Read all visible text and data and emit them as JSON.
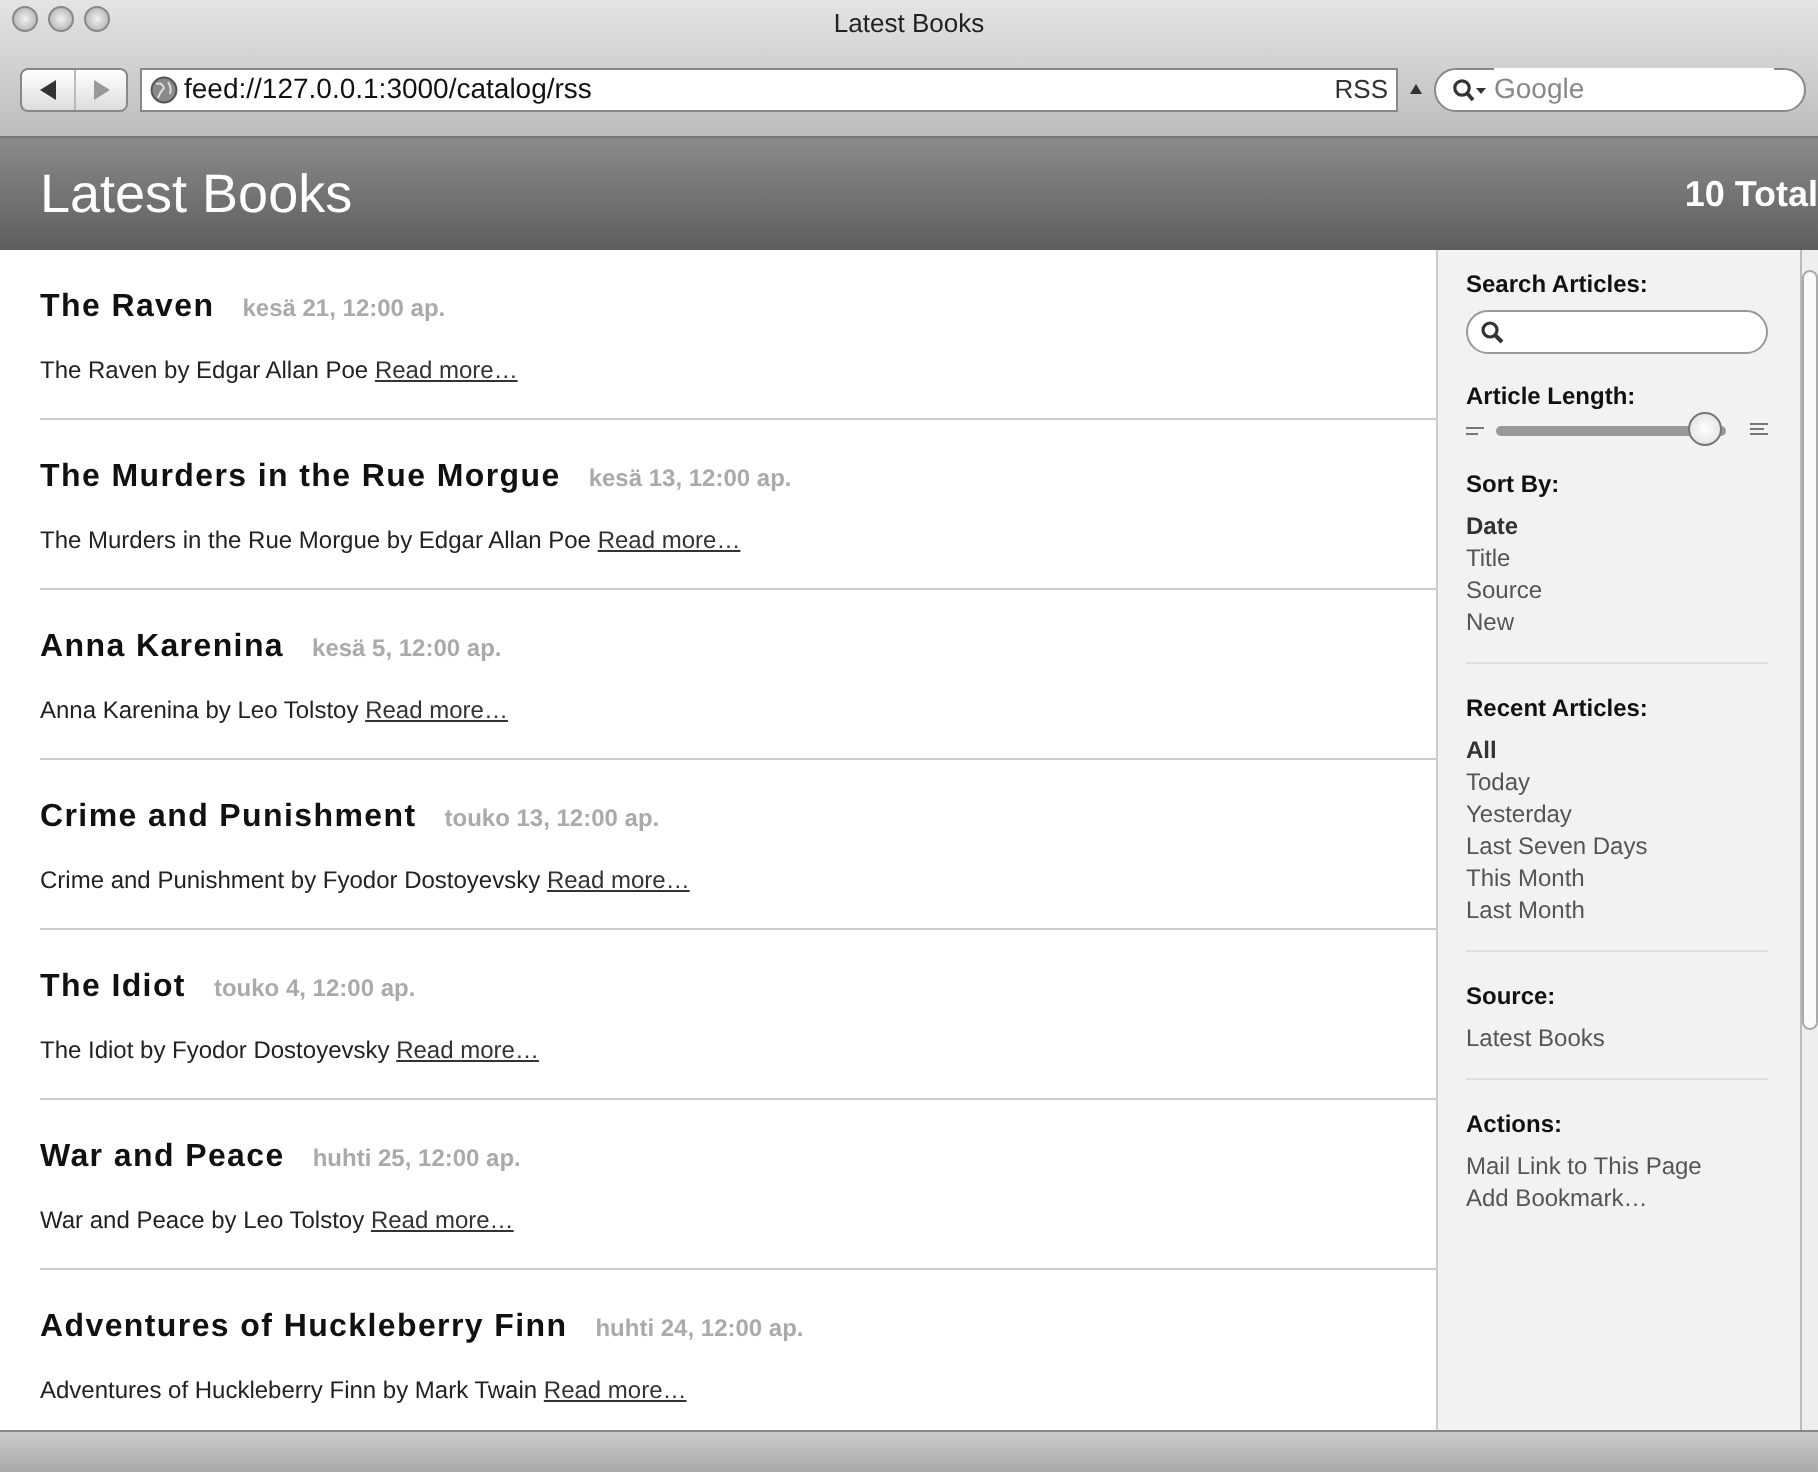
{
  "window": {
    "title": "Latest Books"
  },
  "toolbar": {
    "address": "feed://127.0.0.1:3000/catalog/rss",
    "rss": "RSS",
    "search": {
      "placeholder": "Google"
    }
  },
  "header": {
    "title": "Latest Books",
    "total": "10 Total"
  },
  "articles": [
    {
      "title": "The Raven",
      "date": "kesä 21, 12:00 ap.",
      "summary": "The Raven by Edgar Allan Poe",
      "link": "Read more…"
    },
    {
      "title": "The Murders in the Rue Morgue",
      "date": "kesä 13, 12:00 ap.",
      "summary": "The Murders in the Rue Morgue by Edgar Allan Poe",
      "link": "Read more…"
    },
    {
      "title": "Anna Karenina",
      "date": "kesä 5, 12:00 ap.",
      "summary": "Anna Karenina by Leo Tolstoy",
      "link": "Read more…"
    },
    {
      "title": "Crime and Punishment",
      "date": "touko 13, 12:00 ap.",
      "summary": "Crime and Punishment by Fyodor Dostoyevsky",
      "link": "Read more…"
    },
    {
      "title": "The Idiot",
      "date": "touko 4, 12:00 ap.",
      "summary": "The Idiot by Fyodor Dostoyevsky",
      "link": "Read more…"
    },
    {
      "title": "War and Peace",
      "date": "huhti 25, 12:00 ap.",
      "summary": "War and Peace by Leo Tolstoy",
      "link": "Read more…"
    },
    {
      "title": "Adventures of Huckleberry Finn",
      "date": "huhti 24, 12:00 ap.",
      "summary": "Adventures of Huckleberry Finn by Mark Twain",
      "link": "Read more…"
    }
  ],
  "sidebar": {
    "search": {
      "heading": "Search Articles:"
    },
    "length": {
      "heading": "Article Length:",
      "level": 0.9
    },
    "sections": [
      {
        "heading": "Sort By:",
        "items": [
          {
            "label": "Date",
            "selected": true
          },
          {
            "label": "Title",
            "selected": false
          },
          {
            "label": "Source",
            "selected": false
          },
          {
            "label": "New",
            "selected": false
          }
        ]
      },
      {
        "heading": "Recent Articles:",
        "items": [
          {
            "label": "All",
            "selected": true
          },
          {
            "label": "Today",
            "selected": false
          },
          {
            "label": "Yesterday",
            "selected": false
          },
          {
            "label": "Last Seven Days",
            "selected": false
          },
          {
            "label": "This Month",
            "selected": false
          },
          {
            "label": "Last Month",
            "selected": false
          }
        ]
      },
      {
        "heading": "Source:",
        "items": [
          {
            "label": "Latest Books",
            "selected": false
          }
        ]
      },
      {
        "heading": "Actions:",
        "items": [
          {
            "label": "Mail Link to This Page",
            "selected": false
          },
          {
            "label": "Add Bookmark…",
            "selected": false
          }
        ]
      }
    ]
  }
}
